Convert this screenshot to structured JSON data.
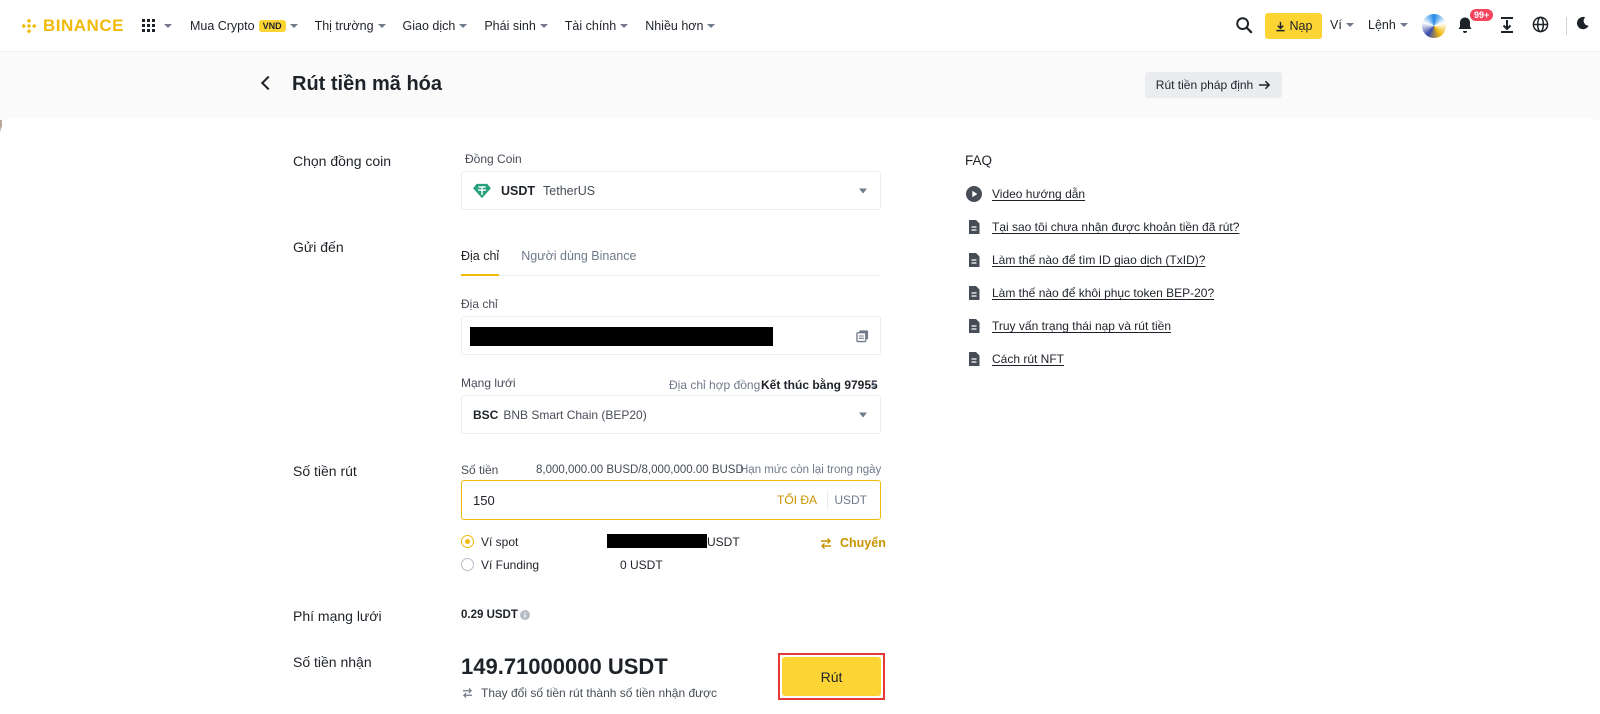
{
  "brand": {
    "name": "BINANCE",
    "accent": "#F0B90B"
  },
  "nav": {
    "items": [
      {
        "label": "Mua Crypto",
        "badge": "VND"
      },
      {
        "label": "Thị trường"
      },
      {
        "label": "Giao dịch"
      },
      {
        "label": "Phái sinh"
      },
      {
        "label": "Tài chính"
      },
      {
        "label": "Nhiều hơn"
      }
    ],
    "deposit_label": "Nạp",
    "wallet_label": "Ví",
    "orders_label": "Lệnh",
    "notification_count": "99+"
  },
  "header": {
    "title": "Rút tiền mã hóa",
    "fiat_button": "Rút tiền pháp định"
  },
  "form": {
    "coin_row_label": "Chọn đồng coin",
    "coin_field_label": "Đồng Coin",
    "coin_symbol": "USDT",
    "coin_name": "TetherUS",
    "send_to_label": "Gửi đến",
    "tabs": [
      "Địa chỉ",
      "Người dùng Binance"
    ],
    "address_label": "Địa chỉ",
    "network_label": "Mạng lưới",
    "contract_label": "Địa chỉ hợp đồng",
    "contract_value": "Kết thúc bằng 97955",
    "network_symbol": "BSC",
    "network_name": "BNB Smart Chain (BEP20)",
    "amount_row_label": "Số tiền rút",
    "amount_field_label": "Số tiền",
    "limit_value": "8,000,000.00 BUSD/8,000,000.00 BUSD",
    "limit_label": "Hạn mức còn lại trong ngày",
    "amount_value": "150",
    "max_label": "TỐI ĐA",
    "amount_unit": "USDT",
    "spot_wallet_label": "Ví spot",
    "spot_wallet_unit": "USDT",
    "transfer_label": "Chuyển",
    "funding_wallet_label": "Ví Funding",
    "funding_wallet_value": "0 USDT",
    "fee_row_label": "Phí mạng lưới",
    "fee_value": "0.29 USDT",
    "receive_row_label": "Số tiền nhận",
    "receive_value": "149.71000000 USDT",
    "switch_hint": "Thay đổi số tiền rút thành số tiền nhận được",
    "submit_label": "Rút"
  },
  "faq": {
    "title": "FAQ",
    "items": [
      {
        "icon": "play-icon",
        "label": "Video hướng dẫn"
      },
      {
        "icon": "document-icon",
        "label": "Tại sao tôi chưa nhận được khoản tiền đã rút?"
      },
      {
        "icon": "document-icon",
        "label": "Làm thế nào để tìm ID giao dịch (TxID)?"
      },
      {
        "icon": "document-icon",
        "label": "Làm thế nào để khôi phục token BEP-20?"
      },
      {
        "icon": "document-icon",
        "label": "Truy vấn trạng thái nạp và rút tiền"
      },
      {
        "icon": "document-icon",
        "label": "Cách rút NFT"
      }
    ]
  }
}
